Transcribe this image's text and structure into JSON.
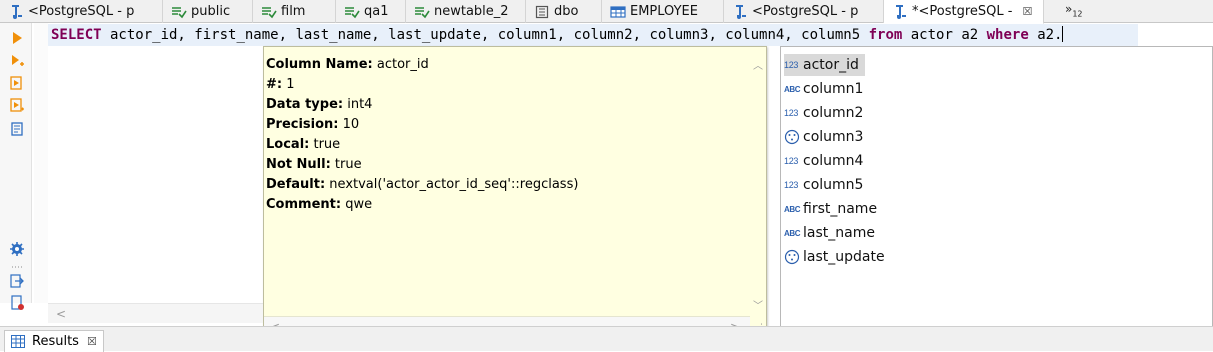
{
  "tabs": [
    {
      "label": "<PostgreSQL - p",
      "icon": "sql-script-icon"
    },
    {
      "label": "public",
      "icon": "schema-icon"
    },
    {
      "label": "film",
      "icon": "schema-icon"
    },
    {
      "label": "qa1",
      "icon": "schema-icon"
    },
    {
      "label": "newtable_2",
      "icon": "schema-icon"
    },
    {
      "label": "dbo",
      "icon": "database-icon"
    },
    {
      "label": "EMPLOYEE",
      "icon": "table-icon"
    },
    {
      "label": "<PostgreSQL - p",
      "icon": "sql-script-icon"
    },
    {
      "label": "*<PostgreSQL -",
      "icon": "sql-script-icon",
      "active": true,
      "close": "☒"
    }
  ],
  "tab_overflow": {
    "symbol": "»",
    "count": "12"
  },
  "editor": {
    "kw_select": "SELECT",
    "cols": " actor_id, first_name, last_name, last_update, column1, column2, column3, column4, column5 ",
    "kw_from": "from",
    "table": " actor a2 ",
    "kw_where": "where",
    "tail": " a2."
  },
  "column_info": {
    "name_label": "Column Name:",
    "name_value": " actor_id",
    "num_label": "#:",
    "num_value": " 1",
    "type_label": "Data type:",
    "type_value": " int4",
    "precision_label": "Precision:",
    "precision_value": " 10",
    "local_label": "Local:",
    "local_value": " true",
    "notnull_label": "Not Null:",
    "notnull_value": " true",
    "default_label": "Default:",
    "default_value": " nextval('actor_actor_id_seq'::regclass)",
    "comment_label": "Comment:",
    "comment_value": " qwe"
  },
  "completion_items": [
    {
      "label": "actor_id",
      "type": "123",
      "selected": true
    },
    {
      "label": "column1",
      "type": "ABC"
    },
    {
      "label": "column2",
      "type": "123"
    },
    {
      "label": "column3",
      "type": "other"
    },
    {
      "label": "column4",
      "type": "123"
    },
    {
      "label": "column5",
      "type": "123"
    },
    {
      "label": "first_name",
      "type": "ABC"
    },
    {
      "label": "last_name",
      "type": "ABC"
    },
    {
      "label": "last_update",
      "type": "other"
    }
  ],
  "results_tab": {
    "label": "Results",
    "close": "☒"
  },
  "colors": {
    "keyword": "#7f0055",
    "tooltip_bg": "#ffffe1",
    "selection": "#d9d9d9",
    "active_line": "#e8f0fa"
  }
}
